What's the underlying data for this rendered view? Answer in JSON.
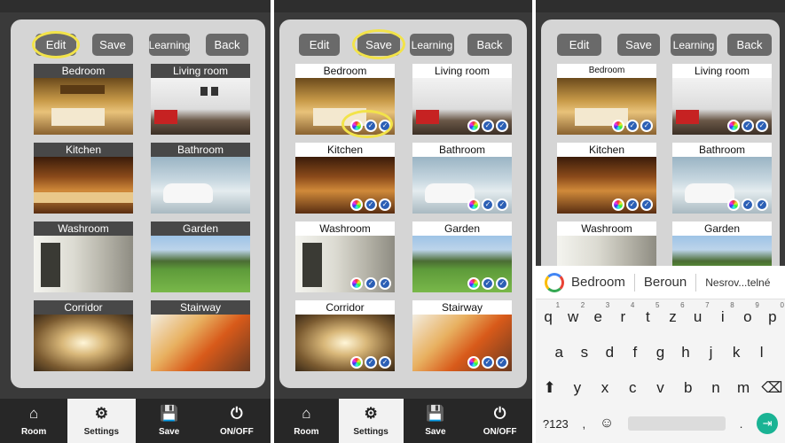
{
  "toolbar": {
    "edit": "Edit",
    "save": "Save",
    "learning": "Learning",
    "back": "Back"
  },
  "rooms": [
    {
      "name": "Bedroom"
    },
    {
      "name": "Living room"
    },
    {
      "name": "Kitchen"
    },
    {
      "name": "Bathroom"
    },
    {
      "name": "Washroom"
    },
    {
      "name": "Garden"
    },
    {
      "name": "Corridor"
    },
    {
      "name": "Stairway"
    }
  ],
  "nav": [
    {
      "label": "Room",
      "icon": "home-icon"
    },
    {
      "label": "Settings",
      "icon": "gear-icon"
    },
    {
      "label": "Save",
      "icon": "save-icon"
    },
    {
      "label": "ON/OFF",
      "icon": "power-icon"
    }
  ],
  "keyboard": {
    "suggestions": [
      "Bedroom",
      "Beroun",
      "Nesrov...telné"
    ],
    "row1": [
      "q",
      "w",
      "e",
      "r",
      "t",
      "z",
      "u",
      "i",
      "o",
      "p"
    ],
    "row1_nums": [
      "1",
      "2",
      "3",
      "4",
      "5",
      "6",
      "7",
      "8",
      "9",
      "0"
    ],
    "row2": [
      "a",
      "s",
      "d",
      "f",
      "g",
      "h",
      "j",
      "k",
      "l"
    ],
    "row3": [
      "y",
      "x",
      "c",
      "v",
      "b",
      "n",
      "m"
    ],
    "symbols": "?123",
    "comma": ",",
    "period": "."
  },
  "colors": {
    "highlight": "#f2e34a",
    "button": "#6a6a6a",
    "panel": "#d5d5d5",
    "enter_key": "#1ab394"
  }
}
